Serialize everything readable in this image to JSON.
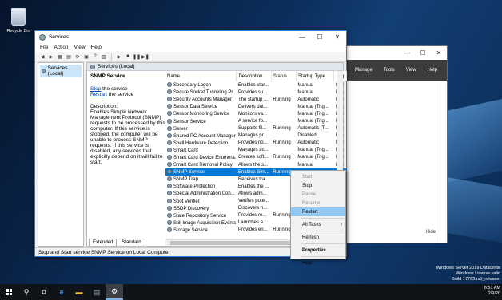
{
  "desktop": {
    "recycle_bin": "Recycle Bin"
  },
  "server_manager": {
    "menu": [
      "Manage",
      "Tools",
      "View",
      "Help"
    ],
    "hide_label": "Hide"
  },
  "services_window": {
    "title": "Services",
    "menu": [
      "File",
      "Action",
      "View",
      "Help"
    ],
    "tree_node": "Services (Local)",
    "pane_header": "Services (Local)",
    "selected_service": "SNMP Service",
    "stop_link": "Stop",
    "stop_suffix": " the service",
    "restart_link": "Restart",
    "restart_suffix": " the service",
    "description_label": "Description:",
    "description_text": "Enables Simple Network Management Protocol (SNMP) requests to be processed by this computer. If this service is stopped, the computer will be unable to process SNMP requests. If this service is disabled, any services that explicitly depend on it will fail to start.",
    "columns": [
      "Name",
      "Description",
      "Status",
      "Startup Type",
      "Log"
    ],
    "rows": [
      [
        "Secondary Logon",
        "Enables star...",
        "",
        "Manual",
        "Loc"
      ],
      [
        "Secure Socket Tunneling Pr...",
        "Provides su...",
        "",
        "Manual",
        "Loc"
      ],
      [
        "Security Accounts Manager",
        "The startup ...",
        "Running",
        "Automatic",
        "Loc"
      ],
      [
        "Sensor Data Service",
        "Delivers dat...",
        "",
        "Manual (Trig...",
        "Loc"
      ],
      [
        "Sensor Monitoring Service",
        "Monitors va...",
        "",
        "Manual (Trig...",
        "Loc"
      ],
      [
        "Sensor Service",
        "A service fo...",
        "",
        "Manual (Trig...",
        "Loc"
      ],
      [
        "Server",
        "Supports fil...",
        "Running",
        "Automatic (T...",
        "Loc"
      ],
      [
        "Shared PC Account Manager",
        "Manages pr...",
        "",
        "Disabled",
        "Loc"
      ],
      [
        "Shell Hardware Detection",
        "Provides no...",
        "Running",
        "Automatic",
        "Loc"
      ],
      [
        "Smart Card",
        "Manages ac...",
        "",
        "Manual (Trig...",
        "Loc"
      ],
      [
        "Smart Card Device Enumera...",
        "Creates soft...",
        "Running",
        "Manual (Trig...",
        "Loc"
      ],
      [
        "Smart Card Removal Policy",
        "Allows the s...",
        "",
        "Manual",
        "Loc"
      ],
      [
        "SNMP Service",
        "Enables Sim...",
        "Running",
        "",
        ""
      ],
      [
        "SNMP Trap",
        "Receives tra...",
        "",
        "",
        ""
      ],
      [
        "Software Protection",
        "Enables the ...",
        "",
        "",
        ""
      ],
      [
        "Special Administration Con...",
        "Allows adm...",
        "",
        "",
        ""
      ],
      [
        "Spot Verifier",
        "Verifies pote...",
        "",
        "",
        ""
      ],
      [
        "SSDP Discovery",
        "Discovers n...",
        "",
        "",
        ""
      ],
      [
        "State Repository Service",
        "Provides re...",
        "Running",
        "",
        ""
      ],
      [
        "Still Image Acquisition Events",
        "Launches a...",
        "",
        "",
        ""
      ],
      [
        "Storage Service",
        "Provides en...",
        "Running",
        "",
        ""
      ]
    ],
    "tabs": [
      "Extended",
      "Standard"
    ],
    "status_text": "Stop and Start service SNMP Service on Local Computer"
  },
  "context_menu": {
    "start": "Start",
    "stop": "Stop",
    "pause": "Pause",
    "resume": "Resume",
    "restart": "Restart",
    "all_tasks": "All Tasks",
    "refresh": "Refresh",
    "properties": "Properties",
    "help": "Help"
  },
  "watermark": {
    "line1": "Windows Server 2019 Datacente",
    "line2": "Windows License valid",
    "line3": "Build 17763.rs5_release."
  },
  "clock": {
    "time": "6:51 AM",
    "date": "2/9/20"
  }
}
